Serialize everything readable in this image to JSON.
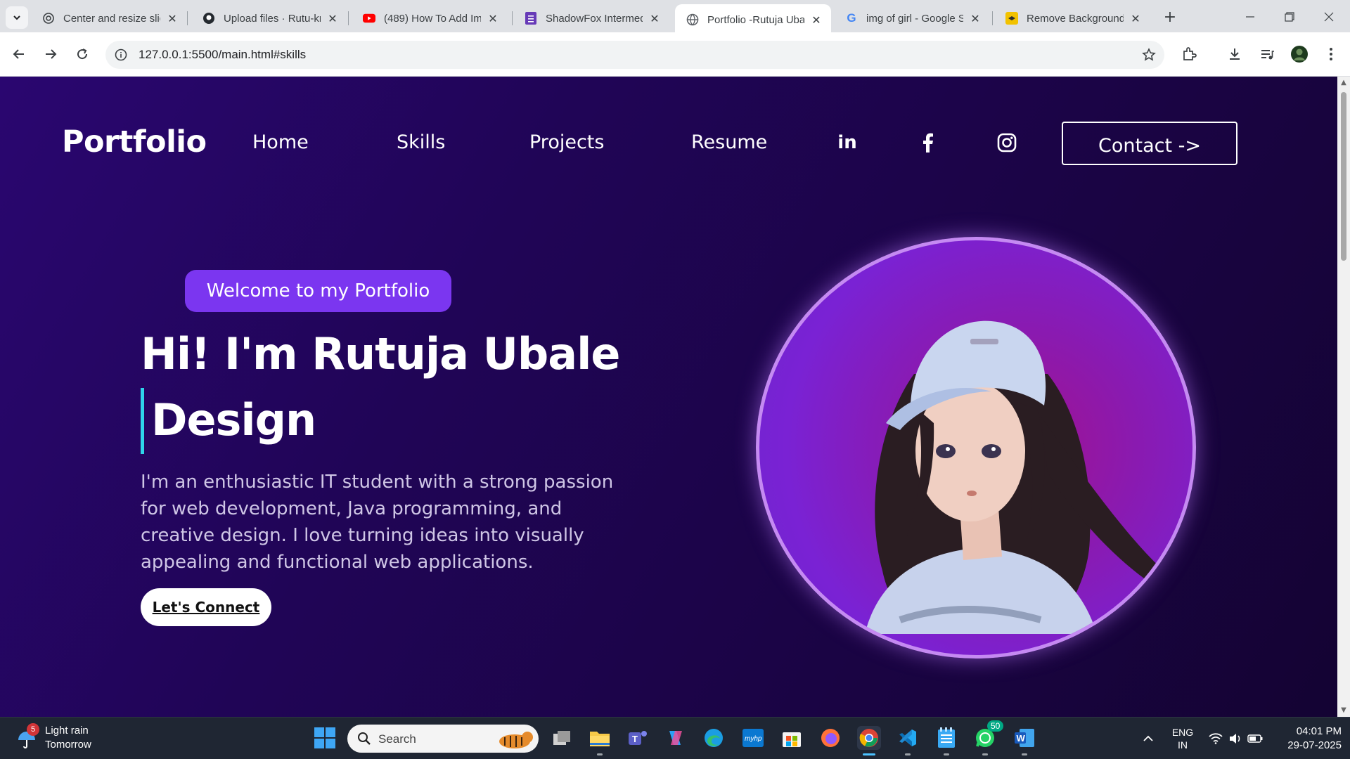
{
  "browser": {
    "tabs": [
      {
        "title": "Center and resize slid",
        "icon": "openai-icon"
      },
      {
        "title": "Upload files · Rutu-kr",
        "icon": "github-icon"
      },
      {
        "title": "(489) How To Add Im",
        "icon": "youtube-icon"
      },
      {
        "title": "ShadowFox Intermed",
        "icon": "forms-icon"
      },
      {
        "title": "Portfolio -Rutuja Uba",
        "icon": "globe-icon",
        "active": true
      },
      {
        "title": "img of girl - Google S",
        "icon": "google-icon"
      },
      {
        "title": "Remove Background",
        "icon": "removebg-icon"
      }
    ],
    "url": "127.0.0.1:5500/main.html#skills"
  },
  "page": {
    "logo": "Portfolio",
    "nav": {
      "home": "Home",
      "skills": "Skills",
      "projects": "Projects",
      "resume": "Resume",
      "linkedin": "in",
      "contact": "Contact ->"
    },
    "hero": {
      "badge": "Welcome to my Portfolio",
      "title": "Hi! I'm Rutuja Ubale",
      "typed": "Design",
      "intro": "I'm an enthusiastic IT student with a strong passion for web development, Java programming, and creative design. I love turning ideas into visually appealing and functional web applications.",
      "cta": "Let's Connect"
    },
    "colors": {
      "background": "#200556",
      "accent": "#7b36f0",
      "cursor": "#2fd4ea"
    }
  },
  "taskbar": {
    "weather": {
      "title": "Light rain",
      "subtitle": "Tomorrow",
      "badge": "5"
    },
    "search": "Search",
    "whatsapp_badge": "50",
    "lang1": "ENG",
    "lang2": "IN",
    "time": "04:01 PM",
    "date": "29-07-2025"
  }
}
